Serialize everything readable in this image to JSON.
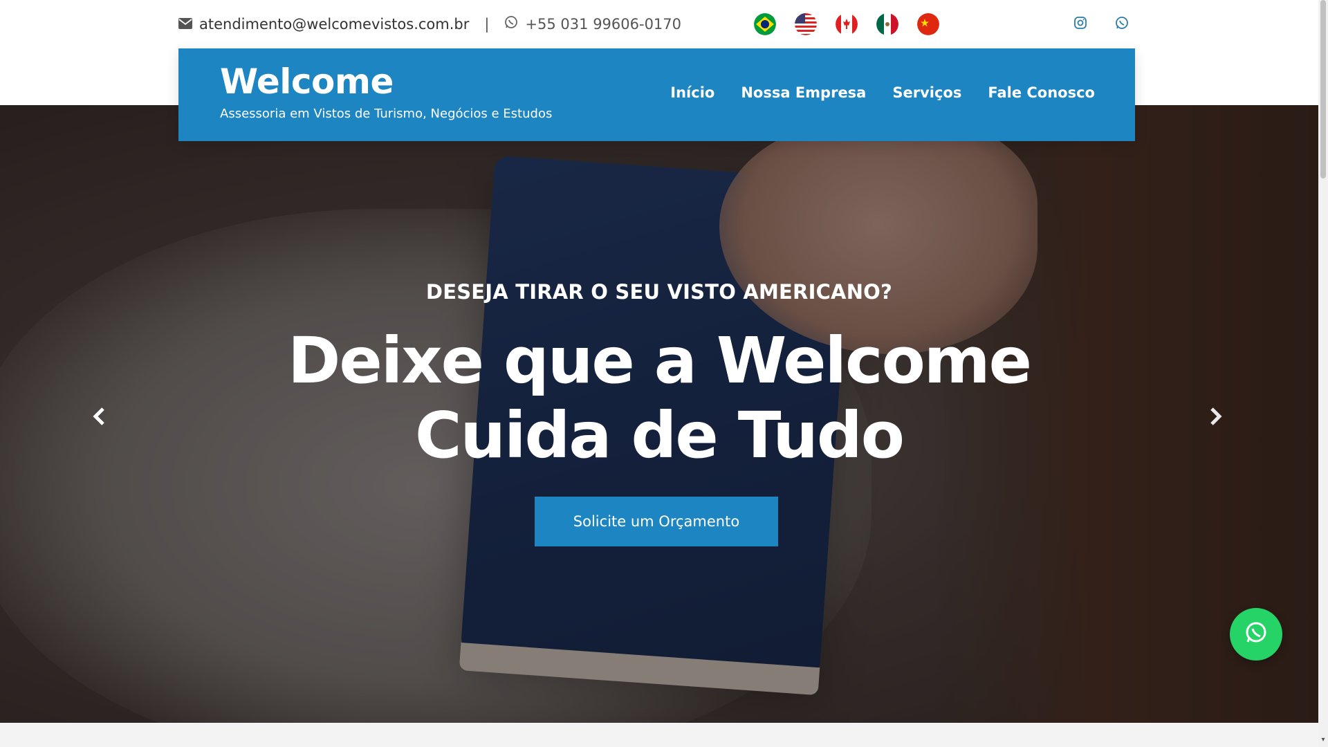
{
  "topbar": {
    "email": "atendimento@welcomevistos.com.br",
    "separator": "|",
    "phone": "+55 031 99606-0170",
    "flags": [
      "brazil-flag",
      "usa-flag",
      "canada-flag",
      "mexico-flag",
      "china-flag"
    ],
    "social": [
      "instagram-icon",
      "whatsapp-icon"
    ]
  },
  "header": {
    "brand_name": "Welcome",
    "tagline": "Assessoria em Vistos de Turismo, Negócios e Estudos",
    "nav": [
      "Início",
      "Nossa Empresa",
      "Serviços",
      "Fale Conosco"
    ]
  },
  "hero": {
    "eyebrow": "DESEJA TIRAR O SEU VISTO AMERICANO?",
    "headline_line1": "Deixe que a Welcome",
    "headline_line2": "Cuida de Tudo",
    "cta": "Solicite um Orçamento",
    "prev_icon": "chevron-left-icon",
    "next_icon": "chevron-right-icon"
  },
  "colors": {
    "brand_blue": "#1d85c2",
    "whatsapp_green": "#25d366"
  }
}
